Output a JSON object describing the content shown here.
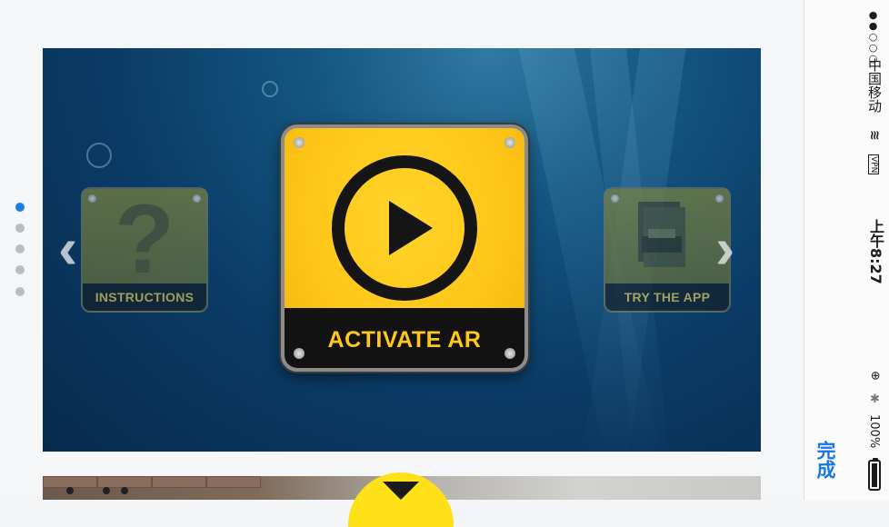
{
  "carousel": {
    "tiles": {
      "left": {
        "label": "INSTRUCTIONS",
        "icon": "question-mark-icon"
      },
      "center": {
        "label": "ACTIVATE AR",
        "icon": "play-icon"
      },
      "right": {
        "label": "TRY THE APP",
        "icon": "printer-icon"
      }
    },
    "prev_arrow": "‹",
    "next_arrow": "›",
    "page_indicator": {
      "count": 5,
      "active_index": 0
    },
    "accent_color": "#ffc719"
  },
  "status_bar": {
    "carrier": "中国移动",
    "vpn": "VPN",
    "time": "上午8:27",
    "battery_percent": "100%",
    "signal": "●●○○○",
    "done_label": "完成",
    "link_color": "#1576e5"
  }
}
